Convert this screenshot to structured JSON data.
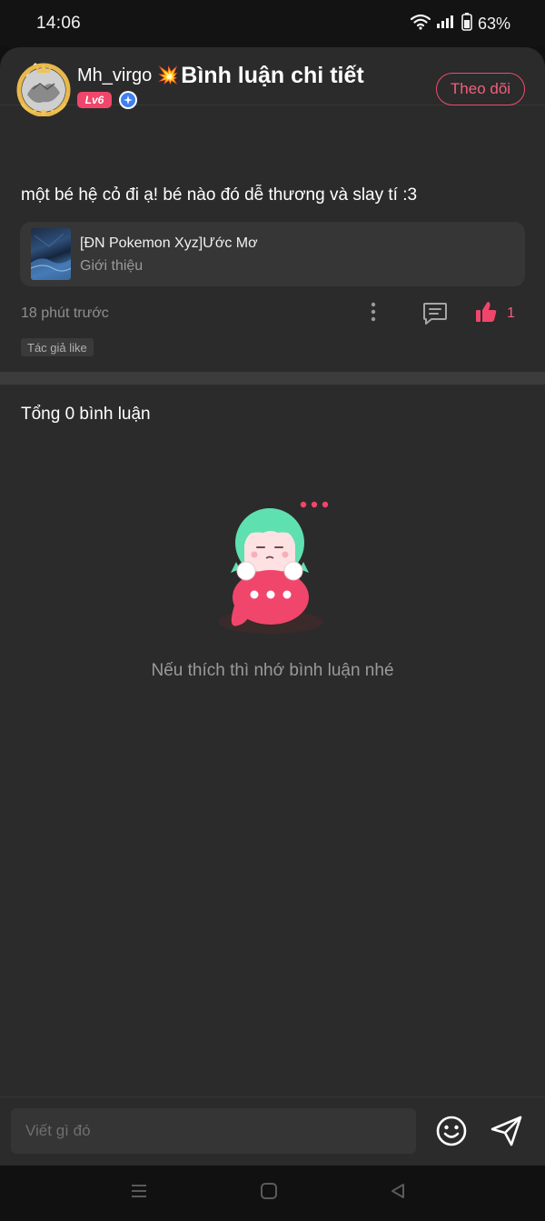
{
  "status_bar": {
    "time": "14:06",
    "battery": "63%",
    "icons": [
      "wifi-icon",
      "signal-icon",
      "battery-icon"
    ]
  },
  "header": {
    "title": "Bình luận chi tiết",
    "back_icon": "chevron-left-icon"
  },
  "post": {
    "author": {
      "name": "Mh_virgo",
      "name_emoji": "💥",
      "level": "Lv6",
      "verified_icon": "verified-badge-icon"
    },
    "follow_label": "Theo dõi",
    "text": "một bé hệ cỏ đi ạ! bé nào đó dễ thương và slay tí :3",
    "story": {
      "title": "[ĐN Pokemon Xyz]Ước Mơ",
      "subtitle": "Giới thiệu"
    },
    "time": "18 phút trước",
    "like_count": "1",
    "author_like_tag": "Tác giả like"
  },
  "comments": {
    "total_label": "Tổng 0 bình luận",
    "empty_message": "Nếu thích thì nhớ bình luận nhé"
  },
  "input": {
    "placeholder": "Viết gì đó"
  },
  "colors": {
    "accent": "#f0466b",
    "background": "#2b2b2b",
    "surface": "#363636",
    "mint": "#5fe0b0"
  }
}
